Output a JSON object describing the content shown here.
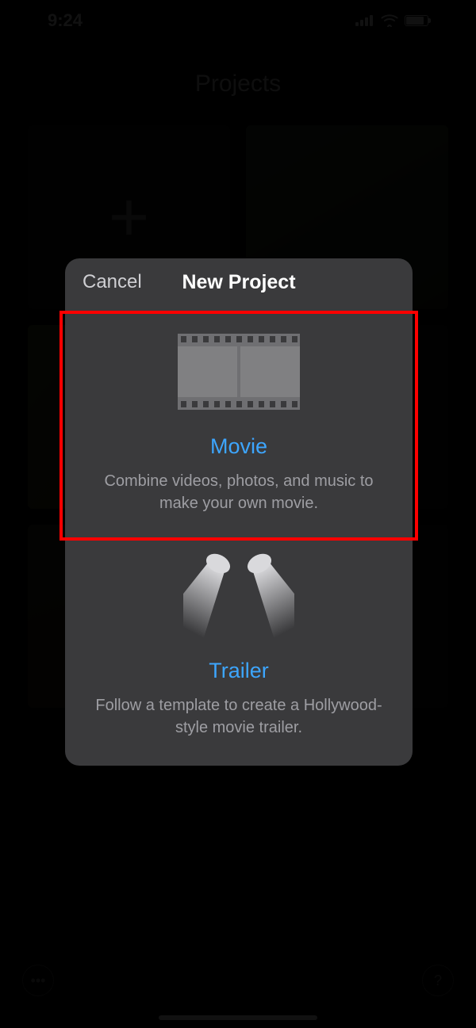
{
  "status": {
    "time": "9:24"
  },
  "page": {
    "title": "Projects"
  },
  "dialog": {
    "cancel": "Cancel",
    "title": "New Project",
    "movie": {
      "label": "Movie",
      "desc": "Combine videos, photos, and music to make your own movie."
    },
    "trailer": {
      "label": "Trailer",
      "desc": "Follow a template to create a Hollywood-style movie trailer."
    }
  },
  "buttons": {
    "more": "•••",
    "help": "?"
  }
}
